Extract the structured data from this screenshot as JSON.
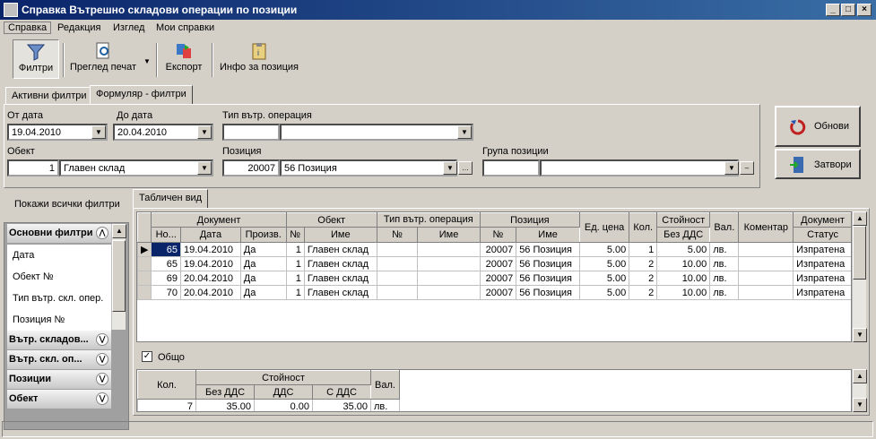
{
  "window": {
    "title": "Справка Вътрешно складови операции по позиции"
  },
  "menu": [
    "Справка",
    "Редакция",
    "Изглед",
    "Мои справки"
  ],
  "toolbar": {
    "filters": "Филтри",
    "preview": "Преглед печат",
    "export": "Експорт",
    "info": "Инфо за позиция"
  },
  "tabs": {
    "active_filters": "Активни филтри",
    "form_filters": "Формуляр - филтри"
  },
  "form": {
    "from_date_label": "От дата",
    "from_date": "19.04.2010",
    "to_date_label": "До дата",
    "to_date": "20.04.2010",
    "op_type_label": "Тип вътр. операция",
    "object_label": "Обект",
    "object_no": "1",
    "object_name": "Главен склад",
    "position_label": "Позиция",
    "position_no": "20007",
    "position_name": "56 Позиция",
    "group_label": "Група позиции"
  },
  "buttons": {
    "refresh": "Обнови",
    "close": "Затвори"
  },
  "sidebar": {
    "show_all": "Покажи всички филтри",
    "main_filters": "Основни филтри",
    "main_items": [
      "Дата",
      "Обект №",
      "Тип вътр. скл. опер.",
      "Позиция №"
    ],
    "groups": [
      "Вътр. складов...",
      "Вътр. скл. оп...",
      "Позиции",
      "Обект"
    ]
  },
  "grid_tab": "Табличен вид",
  "grid": {
    "group_headers": {
      "document": "Документ",
      "object": "Обект",
      "op_type": "Тип вътр. операция",
      "position": "Позиция",
      "unit_price": "Ед. цена",
      "qty": "Кол.",
      "value": "Стойност",
      "currency": "Вал.",
      "comment": "Коментар",
      "doc_status_top": "Документ"
    },
    "sub_headers": {
      "doc_no": "Но...",
      "date": "Дата",
      "prod": "Произв.",
      "obj_no": "№",
      "obj_name": "Име",
      "op_no": "№",
      "op_name": "Име",
      "pos_no": "№",
      "pos_name": "Име",
      "no_vat": "Без ДДС",
      "status": "Статус"
    },
    "rows": [
      [
        "65",
        "19.04.2010",
        "Да",
        "1",
        "Главен склад",
        "",
        "",
        "20007",
        "56 Позиция",
        "5.00",
        "1",
        "5.00",
        "лв.",
        "",
        "Изпратена"
      ],
      [
        "65",
        "19.04.2010",
        "Да",
        "1",
        "Главен склад",
        "",
        "",
        "20007",
        "56 Позиция",
        "5.00",
        "2",
        "10.00",
        "лв.",
        "",
        "Изпратена"
      ],
      [
        "69",
        "20.04.2010",
        "Да",
        "1",
        "Главен склад",
        "",
        "",
        "20007",
        "56 Позиция",
        "5.00",
        "2",
        "10.00",
        "лв.",
        "",
        "Изпратена"
      ],
      [
        "70",
        "20.04.2010",
        "Да",
        "1",
        "Главен склад",
        "",
        "",
        "20007",
        "56 Позиция",
        "5.00",
        "2",
        "10.00",
        "лв.",
        "",
        "Изпратена"
      ]
    ]
  },
  "totals": {
    "checkbox_label": "Общо",
    "qty_header": "Кол.",
    "value_header": "Стойност",
    "no_vat": "Без ДДС",
    "vat": "ДДС",
    "with_vat": "С ДДС",
    "currency_header": "Вал.",
    "qty": "7",
    "no_vat_value": "35.00",
    "vat_value": "0.00",
    "with_vat_value": "35.00",
    "currency": "лв."
  }
}
